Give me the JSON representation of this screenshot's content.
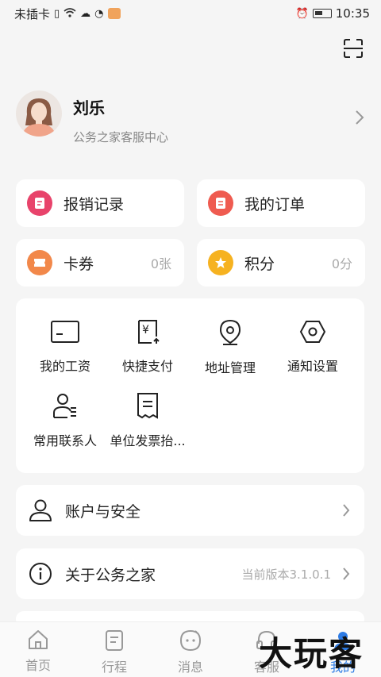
{
  "status_bar": {
    "carrier": "未插卡",
    "time": "10:35",
    "icons": [
      "sim-alert-icon",
      "wifi-icon",
      "cloud-icon",
      "timer-icon",
      "chat-app-icon",
      "alarm-icon",
      "battery-icon"
    ]
  },
  "header": {
    "scan_icon": "scan-icon"
  },
  "profile": {
    "name": "刘乐",
    "subtitle": "公务之家客服中心"
  },
  "quick_cards": {
    "expense": {
      "label": "报销记录",
      "color": "#e8436b"
    },
    "orders": {
      "label": "我的订单",
      "color": "#ef5b50"
    },
    "coupons": {
      "label": "卡券",
      "value": "0张",
      "color": "#f2884a"
    },
    "points": {
      "label": "积分",
      "value": "0分",
      "color": "#f6b220"
    }
  },
  "grid": [
    {
      "label": "我的工资",
      "icon": "card-icon"
    },
    {
      "label": "快捷支付",
      "icon": "yen-receipt-icon"
    },
    {
      "label": "地址管理",
      "icon": "location-pin-icon"
    },
    {
      "label": "通知设置",
      "icon": "hexagon-settings-icon"
    },
    {
      "label": "常用联系人",
      "icon": "contacts-icon"
    },
    {
      "label": "单位发票抬...",
      "icon": "invoice-icon"
    }
  ],
  "rows": {
    "account": {
      "label": "账户与安全"
    },
    "about": {
      "label": "关于公务之家",
      "value": "当前版本3.1.0.1"
    }
  },
  "tabs": [
    {
      "label": "首页",
      "icon": "home-icon"
    },
    {
      "label": "行程",
      "icon": "itinerary-icon"
    },
    {
      "label": "消息",
      "icon": "message-icon"
    },
    {
      "label": "客服",
      "icon": "headset-icon"
    },
    {
      "label": "我的",
      "icon": "profile-icon",
      "active": true
    }
  ],
  "watermark": "大玩客",
  "colors": {
    "accent": "#2d7be5",
    "background": "#f5f5f5"
  }
}
